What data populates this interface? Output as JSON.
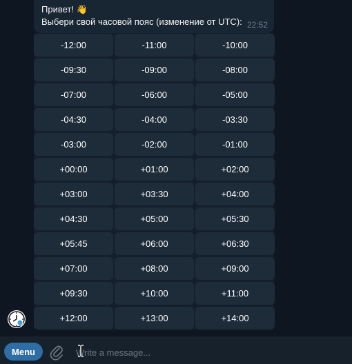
{
  "message": {
    "line1": "Привет! 👋",
    "line2": "Выбери свой часовой пояс (изменение от UTC):",
    "time": "22:52"
  },
  "keyboard": [
    [
      "-12:00",
      "-11:00",
      "-10:00"
    ],
    [
      "-09:30",
      "-09:00",
      "-08:00"
    ],
    [
      "-07:00",
      "-06:00",
      "-05:00"
    ],
    [
      "-04:30",
      "-04:00",
      "-03:30"
    ],
    [
      "-03:00",
      "-02:00",
      "-01:00"
    ],
    [
      "+00:00",
      "+01:00",
      "+02:00"
    ],
    [
      "+03:00",
      "+03:30",
      "+04:00"
    ],
    [
      "+04:30",
      "+05:00",
      "+05:30"
    ],
    [
      "+05:45",
      "+06:00",
      "+06:30"
    ],
    [
      "+07:00",
      "+08:00",
      "+09:00"
    ],
    [
      "+09:30",
      "+10:00",
      "+11:00"
    ],
    [
      "+12:00",
      "+13:00",
      "+14:00"
    ]
  ],
  "input_bar": {
    "menu_label": "Menu",
    "placeholder": "Write a message..."
  },
  "icons": {
    "avatar": "clock-icon",
    "attach": "paperclip-icon"
  },
  "colors": {
    "background": "#0e1621",
    "bubble": "#182533",
    "button": "#1e2c3a",
    "menu_button": "#2f6ea5"
  }
}
